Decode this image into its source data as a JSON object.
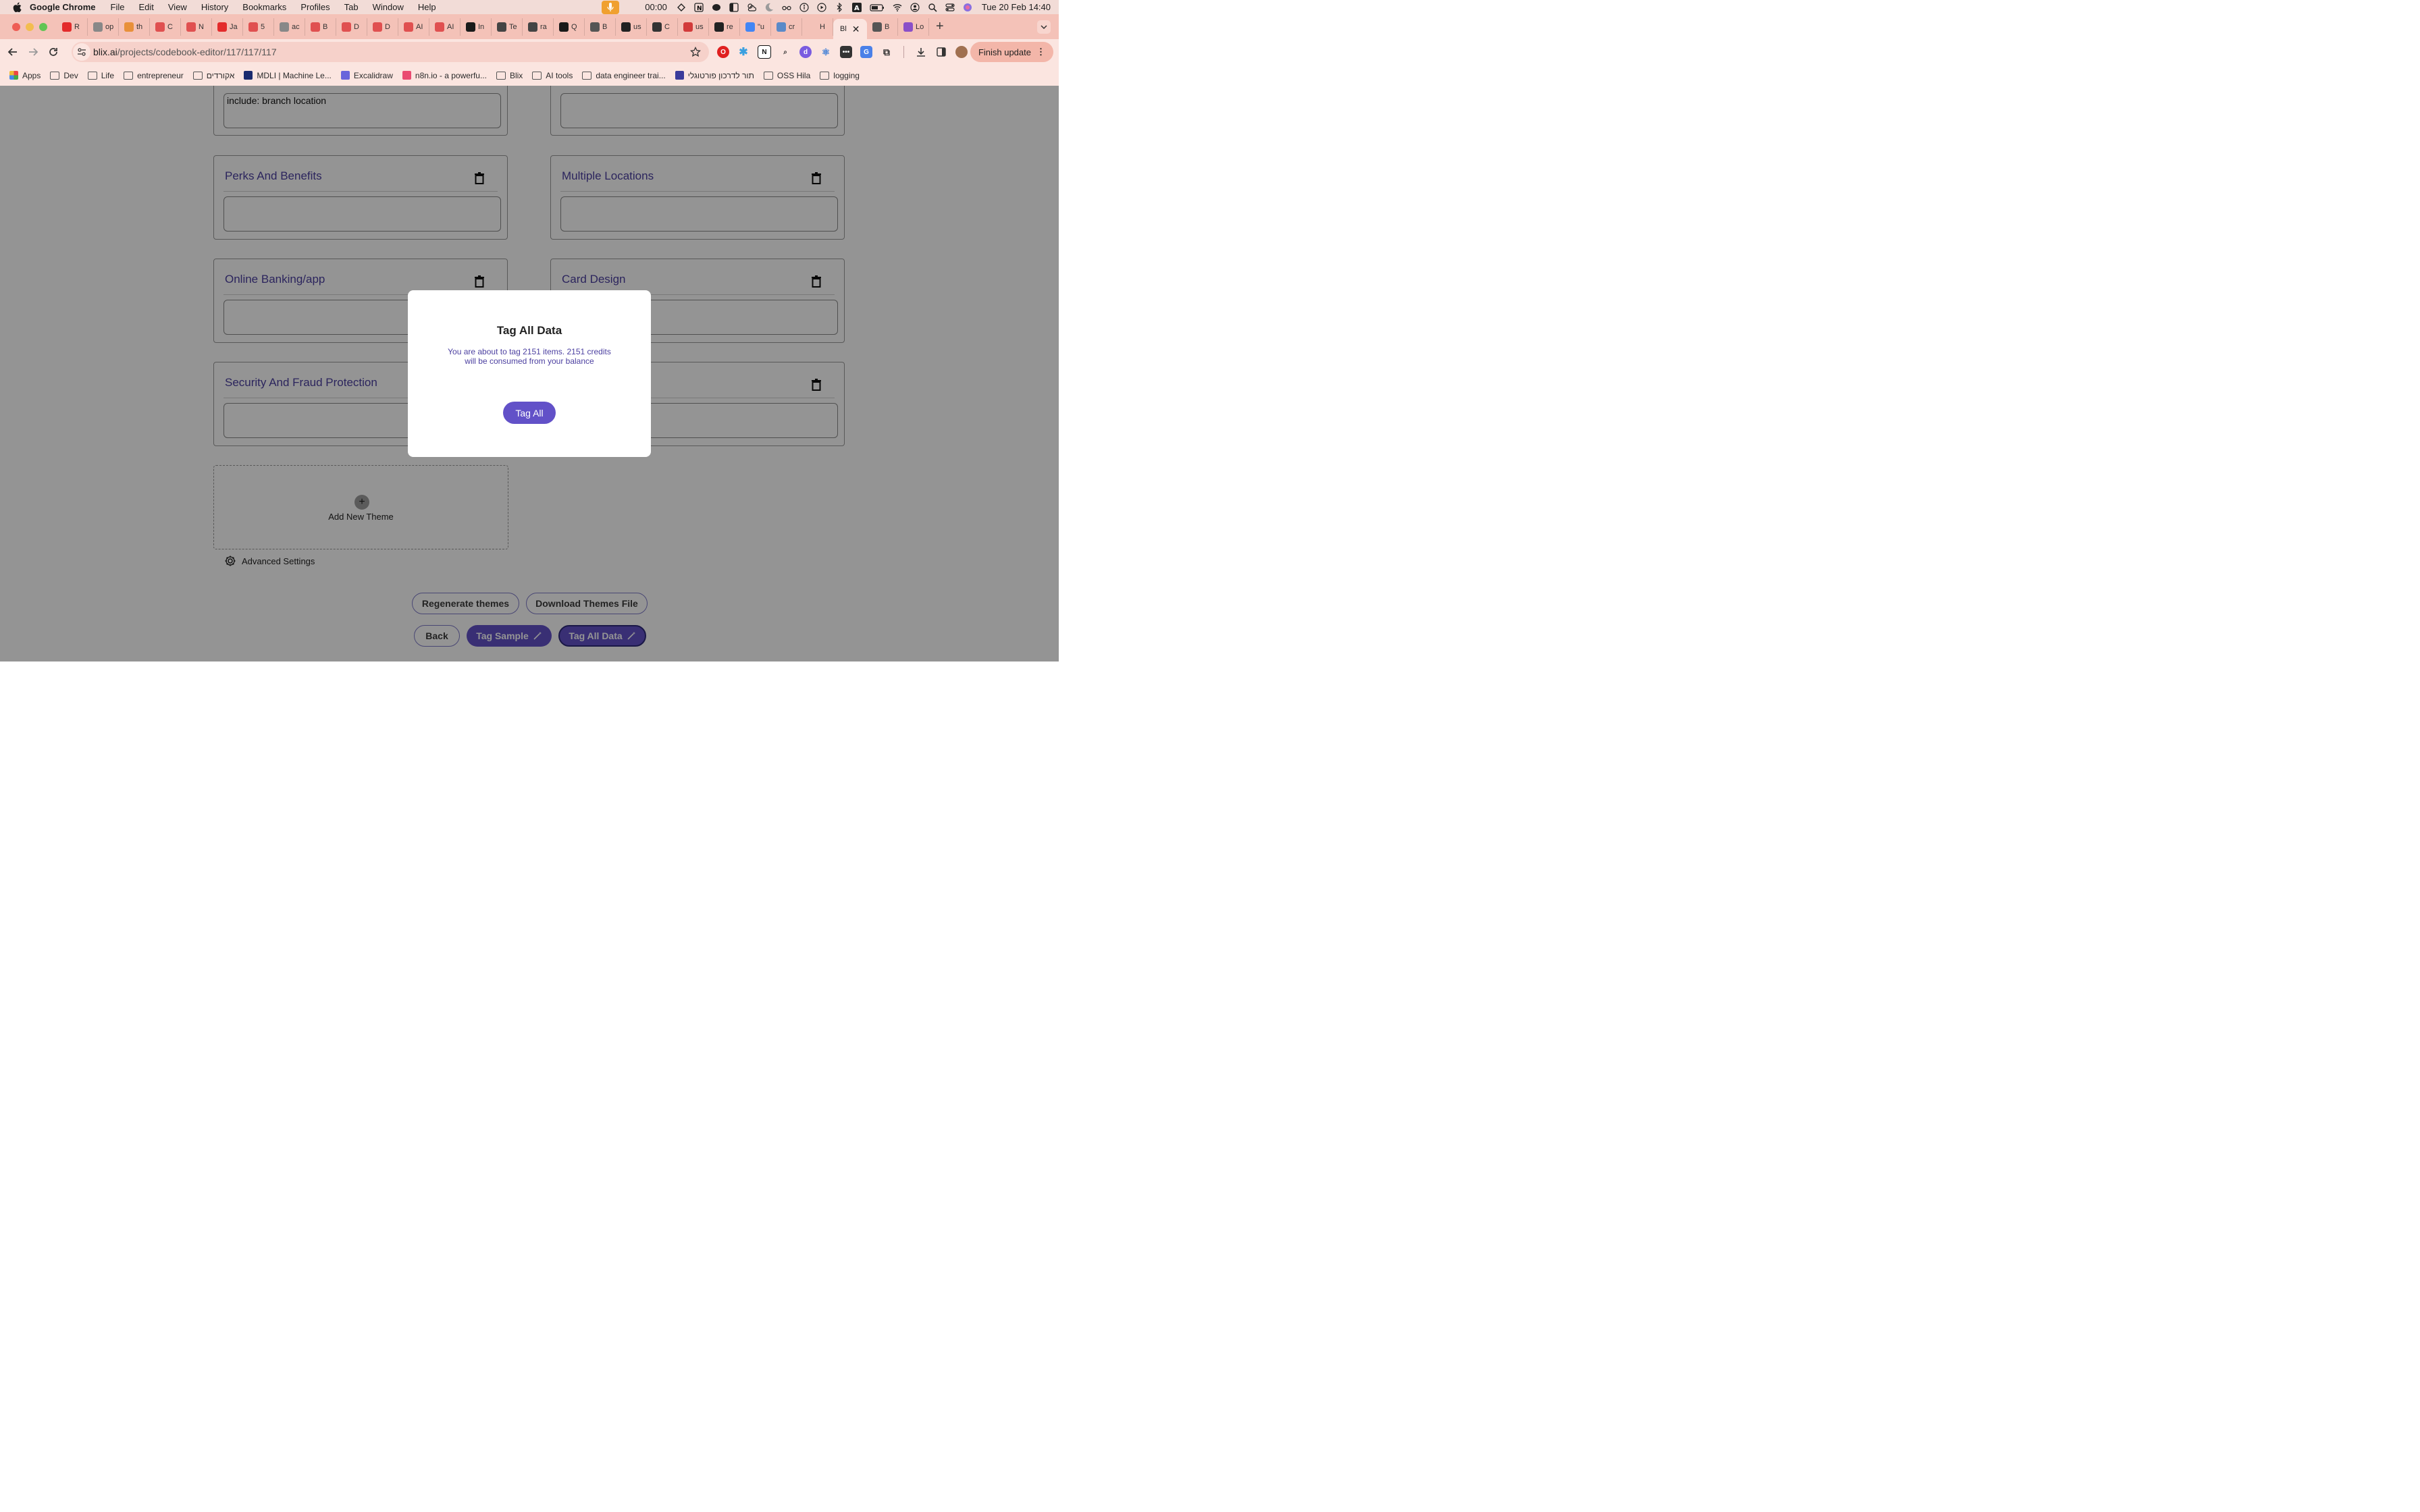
{
  "menubar": {
    "app_name": "Google Chrome",
    "items": [
      "File",
      "Edit",
      "View",
      "History",
      "Bookmarks",
      "Profiles",
      "Tab",
      "Window",
      "Help"
    ],
    "timer": "00:00",
    "datetime": "Tue 20 Feb  14:40"
  },
  "tabs": {
    "items": [
      {
        "label": "R",
        "color": "#e32b2b"
      },
      {
        "label": "op",
        "color": "#888888"
      },
      {
        "label": "th",
        "color": "#e8903a"
      },
      {
        "label": "C",
        "color": "#e05050"
      },
      {
        "label": "N",
        "color": "#e05050"
      },
      {
        "label": "Ja",
        "color": "#e32b2b"
      },
      {
        "label": "5",
        "color": "#e05050"
      },
      {
        "label": "ac",
        "color": "#888888"
      },
      {
        "label": "B",
        "color": "#e05050"
      },
      {
        "label": "D",
        "color": "#e05050"
      },
      {
        "label": "D",
        "color": "#e05050"
      },
      {
        "label": "AI",
        "color": "#e05050"
      },
      {
        "label": "AI",
        "color": "#e05050"
      },
      {
        "label": "In",
        "color": "#1a1a1a"
      },
      {
        "label": "Te",
        "color": "#444444"
      },
      {
        "label": "ra",
        "color": "#444444"
      },
      {
        "label": "Q",
        "color": "#1a1a1a"
      },
      {
        "label": "B",
        "color": "#555555"
      },
      {
        "label": "us",
        "color": "#222222"
      },
      {
        "label": "C",
        "color": "#333333"
      },
      {
        "label": "us",
        "color": "#d23a3a"
      },
      {
        "label": "re",
        "color": "#222222"
      },
      {
        "label": "\"u",
        "color": "#4285f4"
      },
      {
        "label": "cr",
        "color": "#5a8ac8"
      },
      {
        "label": "H",
        "color": "#f4c2b8"
      }
    ],
    "active_label": "Bl",
    "after_active": [
      {
        "label": "B",
        "color": "#555555"
      },
      {
        "label": "Lo",
        "color": "#8a4fc8"
      }
    ]
  },
  "toolbar": {
    "url_host": "blix.ai",
    "url_path": "/projects/codebook-editor/117/117/117",
    "finish_update_label": "Finish update"
  },
  "bookmarks": [
    {
      "label": "Apps",
      "type": "apps"
    },
    {
      "label": "Dev",
      "type": "folder"
    },
    {
      "label": "Life",
      "type": "folder"
    },
    {
      "label": "entrepreneur",
      "type": "folder"
    },
    {
      "label": "אקורדים",
      "type": "folder"
    },
    {
      "label": "MDLI | Machine Le...",
      "type": "site",
      "color": "#1a2a6e"
    },
    {
      "label": "Excalidraw",
      "type": "site",
      "color": "#6965db"
    },
    {
      "label": "n8n.io - a powerfu...",
      "type": "site",
      "color": "#ea4b71"
    },
    {
      "label": "Blix",
      "type": "folder"
    },
    {
      "label": "AI tools",
      "type": "folder"
    },
    {
      "label": "data engineer trai...",
      "type": "folder"
    },
    {
      "label": "תור לדרכון פורטוגלי",
      "type": "site",
      "color": "#3b3b9b"
    },
    {
      "label": "OSS Hila",
      "type": "folder"
    },
    {
      "label": "logging",
      "type": "folder"
    }
  ],
  "themes": {
    "top_left_value": "include: branch location",
    "cards": [
      {
        "title": "Perks And Benefits"
      },
      {
        "title": "Multiple Locations"
      },
      {
        "title": "Online Banking/app"
      },
      {
        "title": "Card Design"
      },
      {
        "title": "Security And Fraud Protection"
      },
      {
        "title": ""
      }
    ],
    "add_new_label": "Add New Theme",
    "advanced_settings_label": "Advanced Settings"
  },
  "actions": {
    "regenerate_label": "Regenerate themes",
    "download_label": "Download Themes File",
    "back_label": "Back",
    "tag_sample_label": "Tag Sample",
    "tag_all_data_label": "Tag All Data"
  },
  "modal": {
    "title": "Tag All Data",
    "message": "You are about to tag 2151 items. 2151 credits will be consumed from your balance",
    "confirm_label": "Tag All"
  },
  "colors": {
    "accent": "#6251c8",
    "theme_title": "#4b3fa0",
    "tab_strip": "#f4c2b8"
  }
}
